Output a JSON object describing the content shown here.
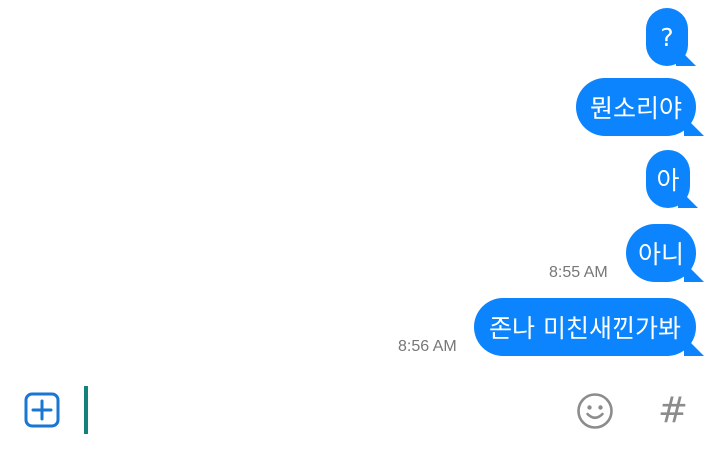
{
  "messages": [
    {
      "text": "?",
      "timestamp": ""
    },
    {
      "text": "뭔소리야",
      "timestamp": ""
    },
    {
      "text": "아",
      "timestamp": ""
    },
    {
      "text": "아니",
      "timestamp": "8:55 AM"
    },
    {
      "text": "존나 미친새낀가봐",
      "timestamp": "8:56 AM"
    }
  ],
  "composer": {
    "add_icon": "plus-square-icon",
    "emoji_icon": "smiley-face-icon",
    "hashtag_label": "#"
  },
  "colors": {
    "bubble": "#0b84fe",
    "bubble_text": "#ffffff",
    "timestamp": "#777777",
    "caret": "#14827a",
    "icon_blue": "#1976d2",
    "icon_gray": "#8c8c8c"
  }
}
